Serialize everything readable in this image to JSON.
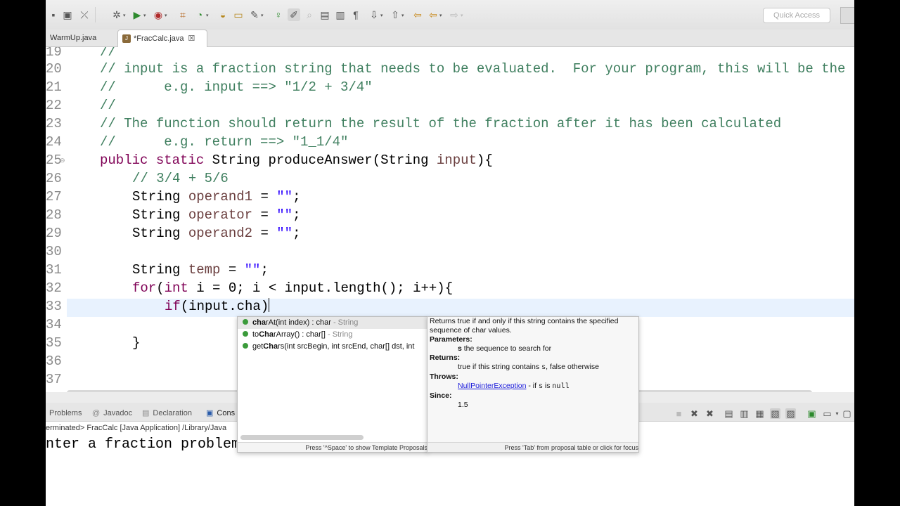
{
  "toolbar": {
    "quick_access_placeholder": "Quick Access"
  },
  "tabs": [
    {
      "label": "WarmUp.java"
    },
    {
      "label": "*FracCalc.java"
    }
  ],
  "editor": {
    "line_numbers": [
      "19",
      "20",
      "21",
      "22",
      "23",
      "24",
      "25",
      "26",
      "27",
      "28",
      "29",
      "30",
      "31",
      "32",
      "33",
      "34",
      "35",
      "36",
      "37"
    ],
    "code": {
      "l19": "//",
      "l20": "// input is a fraction string that needs to be evaluated.  For your program, this will be the u",
      "l21": "//      e.g. input ==> \"1/2 + 3/4\"",
      "l22": "//",
      "l23": "// The function should return the result of the fraction after it has been calculated",
      "l24": "//      e.g. return ==> \"1_1/4\"",
      "l25_kw1": "public",
      "l25_kw2": "static",
      "l25_rest": " String produceAnswer(String ",
      "l25_param": "input",
      "l25_end": "){",
      "l26": "// 3/4 + 5/6",
      "type_string": "String ",
      "op1_name": "operand1",
      "op_name": "operator",
      "op2_name": "operand2",
      "temp_name": "temp",
      "eq": " = ",
      "empty_str": "\"\"",
      "semi": ";",
      "for_kw": "for",
      "int_kw": "int",
      "for_rest1": "(",
      "for_rest2": " i = 0; i < input.length(); i++){",
      "if_kw": "if",
      "if_rest": "(input.cha)",
      "close_brace": "}"
    }
  },
  "content_assist": {
    "items": [
      {
        "bold": "cha",
        "rest": "rAt(int index) : char",
        "type": " - String"
      },
      {
        "pre": "to",
        "bold": "Cha",
        "rest": "rArray() : char[]",
        "type": " - String"
      },
      {
        "pre": "get",
        "bold": "Cha",
        "rest": "rs(int srcBegin, int srcEnd, char[] dst, int",
        "type": ""
      }
    ],
    "footer": "Press '^Space' to show Template Proposals"
  },
  "javadoc": {
    "summary": "Returns true if and only if this string contains the specified sequence of char values.",
    "params_label": "Parameters:",
    "param_name": "s",
    "param_desc": " the sequence to search for",
    "returns_label": "Returns:",
    "returns_pre": "true if this string contains ",
    "returns_code": "s",
    "returns_post": ", false otherwise",
    "throws_label": "Throws:",
    "throws_link": "NullPointerException",
    "throws_pre": " - if ",
    "throws_code1": "s",
    "throws_mid": " is ",
    "throws_code2": "null",
    "since_label": "Since:",
    "since_value": "1.5",
    "footer": "Press 'Tab' from proposal table or click for focus"
  },
  "bottom_panel": {
    "tabs": [
      {
        "label": "Problems"
      },
      {
        "label": "Javadoc"
      },
      {
        "label": "Declaration"
      },
      {
        "label": "Cons"
      }
    ],
    "status": "erminated> FracCalc [Java Application] /Library/Java",
    "console_output": "nter a fraction problem:"
  }
}
